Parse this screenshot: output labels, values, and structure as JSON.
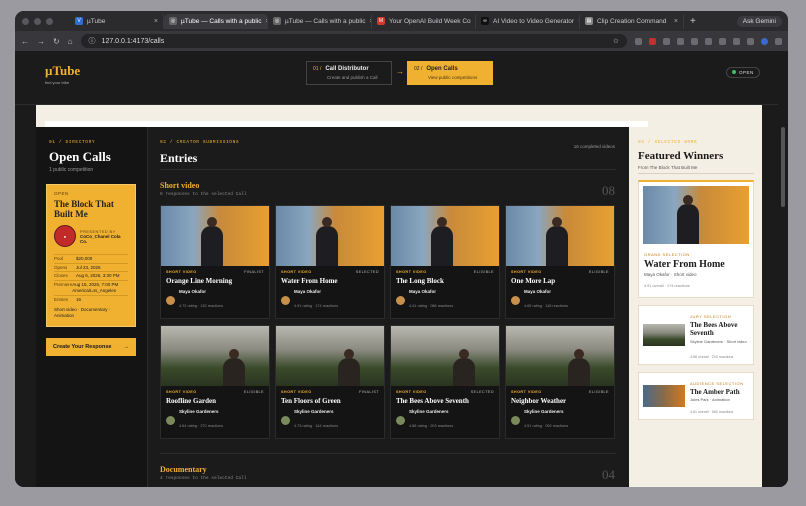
{
  "tabs": [
    {
      "label": "µTube",
      "icon": "youtube-icon",
      "color": "#2f6fd0"
    },
    {
      "label": "µTube — Calls with a public",
      "icon": "globe-icon",
      "color": "#666",
      "active": true
    },
    {
      "label": "µTube — Calls with a public",
      "icon": "globe-icon",
      "color": "#666"
    },
    {
      "label": "Your OpenAI Build Week Co",
      "icon": "gmail-icon",
      "color": "#d0392b"
    },
    {
      "label": "AI Video to Video Generator",
      "icon": "ai-icon",
      "color": "#111"
    },
    {
      "label": "Clip Creation Command",
      "icon": "clipboard-icon",
      "color": "#888"
    }
  ],
  "gemini_label": "Ask Gemini",
  "url": "127.0.0.1:4173/calls",
  "brand": {
    "name": "µTube",
    "tagline": "find your tribe"
  },
  "steps": [
    {
      "num": "01 /",
      "title": "Call Distributor",
      "sub": "Create and publish a Call"
    },
    {
      "num": "02 /",
      "title": "Open Calls",
      "sub": "View public competitions"
    }
  ],
  "status_badge": "OPEN",
  "directory": {
    "kicker": "01 / DIRECTORY",
    "title": "Open Calls",
    "count": "1 public competition",
    "card": {
      "status": "OPEN",
      "title": "The Block That Built Me",
      "presenter_label": "PRESENTED BY",
      "presenter": "CoCo_Chanel Cola Co.",
      "rows": [
        {
          "k": "Pool",
          "v": "$20,000"
        },
        {
          "k": "Opens",
          "v": "Jul 23, 2026"
        },
        {
          "k": "Closes",
          "v": "Aug 6, 2026, 3:30 PM"
        },
        {
          "k": "Premiere",
          "v": "Aug 15, 2026, 7:00 PM America/Los_Angeles"
        },
        {
          "k": "Entries",
          "v": "16"
        }
      ],
      "tags": "Short video · Documentary · Animation"
    },
    "cta": "Create Your Response"
  },
  "entries": {
    "kicker": "02 / CREATOR SUBMISSIONS",
    "title": "Entries",
    "completed": "16 completed videos",
    "short": {
      "title": "Short video",
      "sub": "8 responses to the selected Call",
      "num": "08",
      "items": [
        {
          "cat": "SHORT VIDEO",
          "flag": "FINALIST",
          "title": "Orange Line Morning",
          "creator": "Maya Okafor",
          "stats": "4.72 rating · 132 reactions"
        },
        {
          "cat": "SHORT VIDEO",
          "flag": "SELECTED",
          "title": "Water From Home",
          "creator": "Maya Okafor",
          "stats": "4.91 rating · 174 reactions"
        },
        {
          "cat": "SHORT VIDEO",
          "flag": "ELIGIBLE",
          "title": "The Long Block",
          "creator": "Maya Okafor",
          "stats": "4.41 rating · 086 reactions"
        },
        {
          "cat": "SHORT VIDEO",
          "flag": "ELIGIBLE",
          "title": "One More Lap",
          "creator": "Maya Okafor",
          "stats": "4.65 rating · 118 reactions"
        },
        {
          "cat": "SHORT VIDEO",
          "flag": "ELIGIBLE",
          "title": "Roofline Garden",
          "creator": "Skyline Gardeners",
          "stats": "4.64 rating · 270 reactions"
        },
        {
          "cat": "SHORT VIDEO",
          "flag": "FINALIST",
          "title": "Ten Floors of Green",
          "creator": "Skyline Gardeners",
          "stats": "4.73 rating · 144 reactions"
        },
        {
          "cat": "SHORT VIDEO",
          "flag": "SELECTED",
          "title": "The Bees Above Seventh",
          "creator": "Skyline Gardeners",
          "stats": "4.88 rating · 203 reactions"
        },
        {
          "cat": "SHORT VIDEO",
          "flag": "ELIGIBLE",
          "title": "Neighbor Weather",
          "creator": "Skyline Gardeners",
          "stats": "4.51 rating · 092 reactions"
        }
      ]
    },
    "doc": {
      "title": "Documentary",
      "sub": "4 responses to the selected Call",
      "num": "04"
    }
  },
  "winners": {
    "kicker": "03 / SELECTED WORK",
    "title": "Featured Winners",
    "from": "From The Block That Built Me",
    "grand": {
      "kicker": "GRAND SELECTION",
      "title": "Water From Home",
      "sub": "Maya Okafor · Short video",
      "meta": "4.91 overall · 174 reactions"
    },
    "jury": {
      "kicker": "JURY SELECTION",
      "title": "The Bees Above Seventh",
      "sub": "Skyline Gardeners · Short video",
      "meta": "4.88 overall · 203 reactions"
    },
    "audience": {
      "kicker": "AUDIENCE SELECTION",
      "title": "The Amber Path",
      "sub": "Jules Park · Animation",
      "meta": "4.81 overall · 580 reactions"
    }
  }
}
